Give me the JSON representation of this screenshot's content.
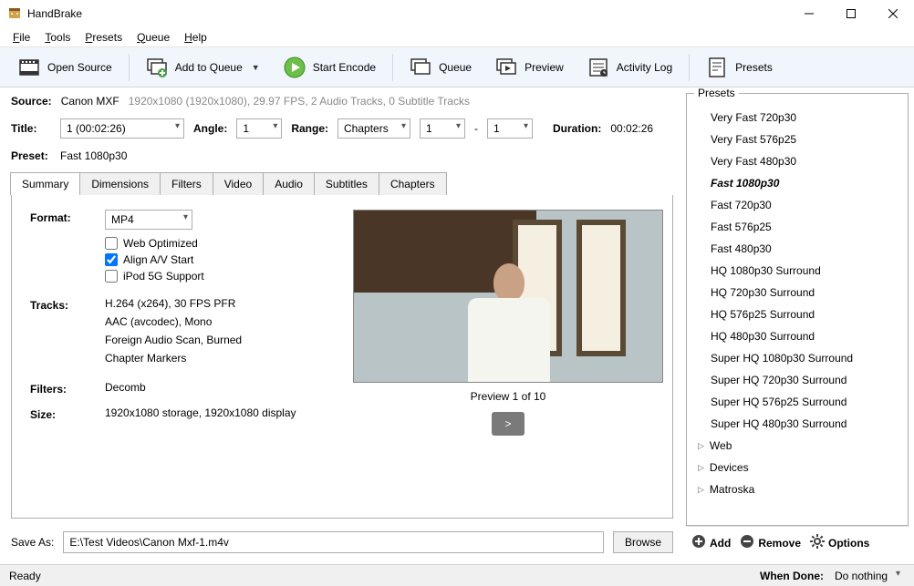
{
  "window": {
    "title": "HandBrake"
  },
  "menu": {
    "file": "File",
    "tools": "Tools",
    "presets": "Presets",
    "queue": "Queue",
    "help": "Help"
  },
  "toolbar": {
    "open_source": "Open Source",
    "add_to_queue": "Add to Queue",
    "start_encode": "Start Encode",
    "queue": "Queue",
    "preview": "Preview",
    "activity_log": "Activity Log",
    "presets": "Presets"
  },
  "source": {
    "label": "Source:",
    "name": "Canon MXF",
    "details": "1920x1080 (1920x1080), 29.97 FPS, 2 Audio Tracks, 0 Subtitle Tracks"
  },
  "title": {
    "label": "Title:",
    "value": "1 (00:02:26)",
    "angle_label": "Angle:",
    "angle_value": "1",
    "range_label": "Range:",
    "range_type": "Chapters",
    "range_from": "1",
    "range_sep": "-",
    "range_to": "1",
    "duration_label": "Duration:",
    "duration_value": "00:02:26"
  },
  "preset_row": {
    "label": "Preset:",
    "value": "Fast 1080p30"
  },
  "tabs": {
    "summary": "Summary",
    "dimensions": "Dimensions",
    "filters": "Filters",
    "video": "Video",
    "audio": "Audio",
    "subtitles": "Subtitles",
    "chapters": "Chapters"
  },
  "summary": {
    "format_label": "Format:",
    "format_value": "MP4",
    "web_optimized": "Web Optimized",
    "align_av": "Align A/V Start",
    "ipod": "iPod 5G Support",
    "tracks_label": "Tracks:",
    "tracks": [
      "H.264 (x264), 30 FPS PFR",
      "AAC (avcodec), Mono",
      "Foreign Audio Scan, Burned",
      "Chapter Markers"
    ],
    "filters_label": "Filters:",
    "filters_value": "Decomb",
    "size_label": "Size:",
    "size_value": "1920x1080 storage, 1920x1080 display",
    "preview_caption": "Preview 1 of 10",
    "preview_next": ">"
  },
  "save": {
    "label": "Save As:",
    "path": "E:\\Test Videos\\Canon Mxf-1.m4v",
    "browse": "Browse"
  },
  "presets": {
    "legend": "Presets",
    "items": [
      "Very Fast 720p30",
      "Very Fast 576p25",
      "Very Fast 480p30",
      "Fast 1080p30",
      "Fast 720p30",
      "Fast 576p25",
      "Fast 480p30",
      "HQ 1080p30 Surround",
      "HQ 720p30 Surround",
      "HQ 576p25 Surround",
      "HQ 480p30 Surround",
      "Super HQ 1080p30 Surround",
      "Super HQ 720p30 Surround",
      "Super HQ 576p25 Surround",
      "Super HQ 480p30 Surround"
    ],
    "categories": [
      "Web",
      "Devices",
      "Matroska"
    ],
    "add": "Add",
    "remove": "Remove",
    "options": "Options"
  },
  "status": {
    "ready": "Ready",
    "when_done_label": "When Done:",
    "when_done_value": "Do nothing"
  }
}
